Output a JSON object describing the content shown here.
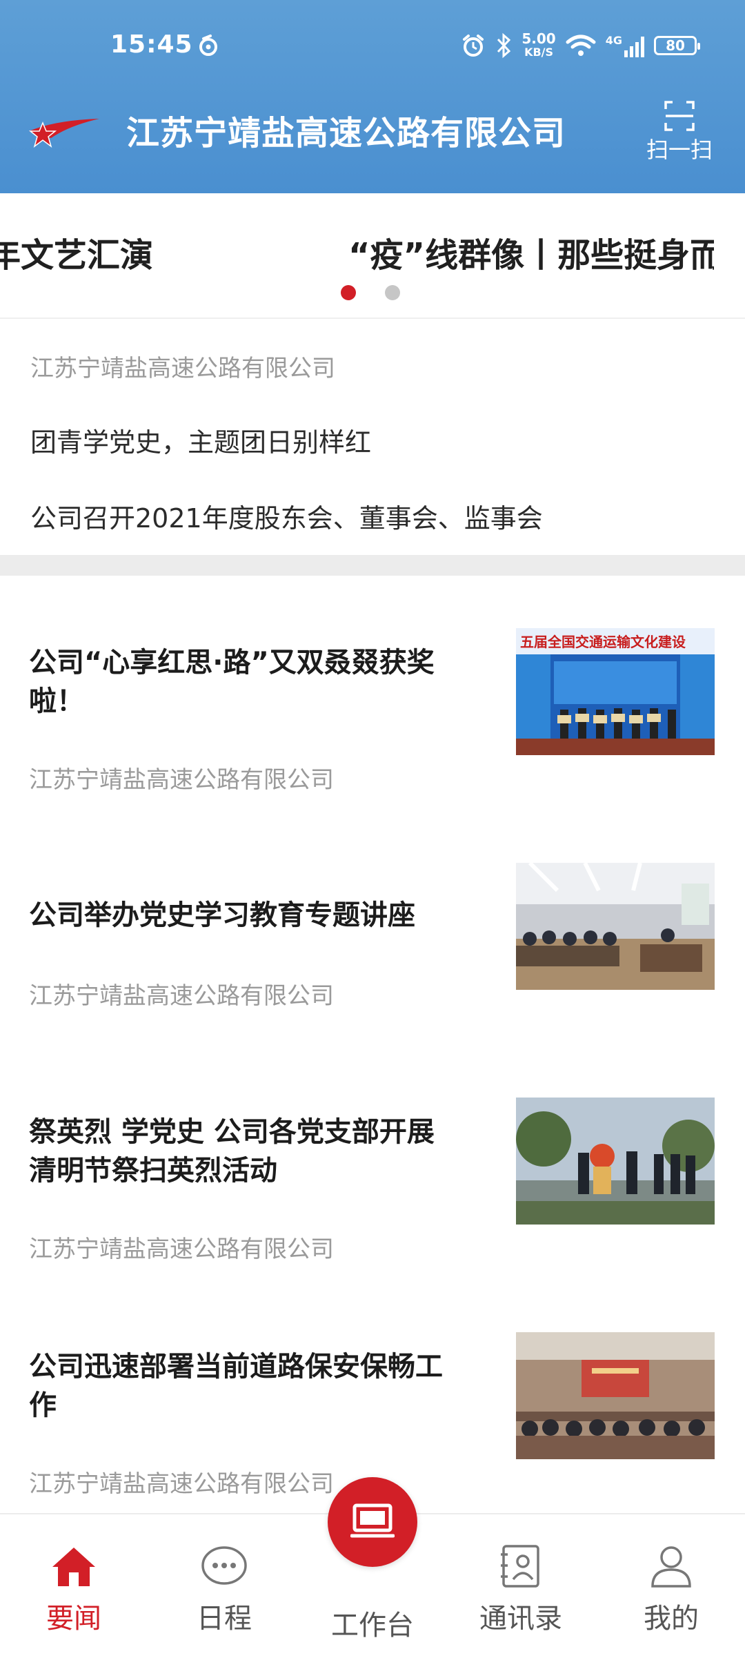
{
  "status_bar": {
    "time": "15:45",
    "net_speed": "5.00",
    "net_unit": "KB/S",
    "signal": "4G",
    "battery": "80"
  },
  "header": {
    "title": "江苏宁靖盐高速公路有限公司",
    "scan_label": "扫一扫",
    "brand_color": "#4a8fd0"
  },
  "carousel": {
    "slides": [
      "年文艺汇演",
      "“疫”线群像丨那些挺身而出"
    ],
    "active_index": 0,
    "accent": "#d21f27"
  },
  "notice": {
    "source": "江苏宁靖盐高速公路有限公司",
    "items": [
      "团青学党史，主题团日别样红",
      "公司召开2021年度股东会、董事会、监事会"
    ]
  },
  "news": [
    {
      "title": "公司“心享红思·路”又双叒叕获奖啦！",
      "source": "江苏宁靖盐高速公路有限公司",
      "thumb_caption": "五届全国交通运输文化建设"
    },
    {
      "title": "公司举办党史学习教育专题讲座",
      "source": "江苏宁靖盐高速公路有限公司"
    },
    {
      "title": "祭英烈 学党史 公司各党支部开展清明节祭扫英烈活动",
      "source": "江苏宁靖盐高速公路有限公司"
    },
    {
      "title": "公司迅速部署当前道路保安保畅工作",
      "source": "江苏宁靖盐高速公路有限公司"
    }
  ],
  "bottom_nav": {
    "items": [
      "要闻",
      "日程",
      "工作台",
      "通讯录",
      "我的"
    ],
    "active": "要闻"
  }
}
